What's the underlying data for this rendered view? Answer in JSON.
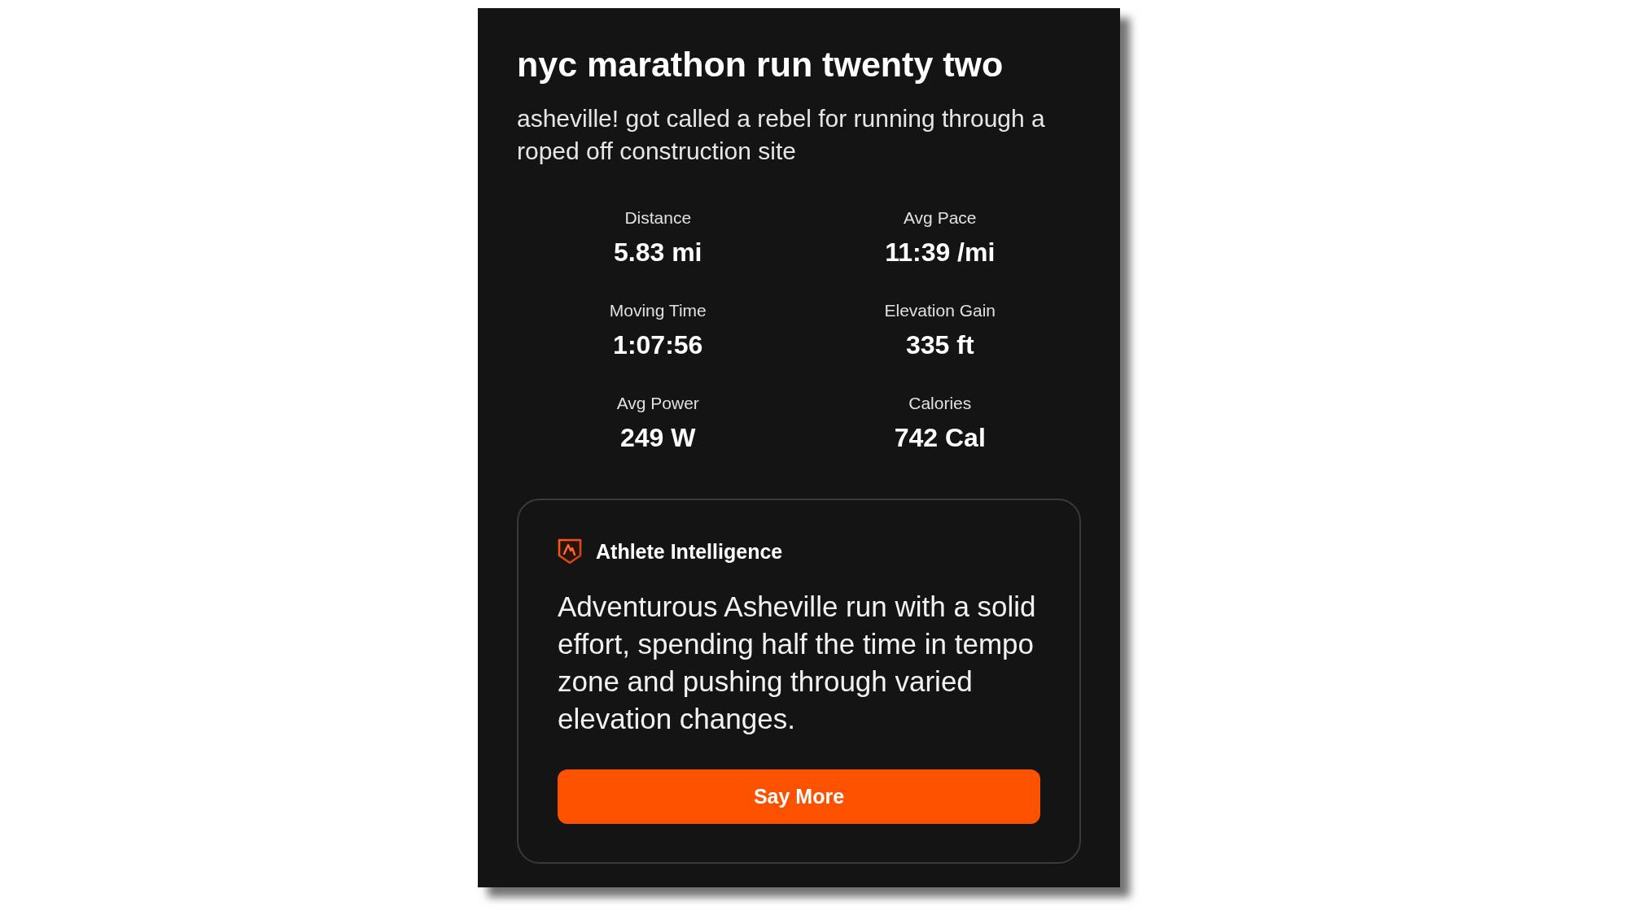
{
  "activity": {
    "title": "nyc marathon run twenty two",
    "description": "asheville! got called a rebel for running through a roped off construction site"
  },
  "stats": [
    {
      "label": "Distance",
      "value": "5.83 mi"
    },
    {
      "label": "Avg Pace",
      "value": "11:39 /mi"
    },
    {
      "label": "Moving Time",
      "value": "1:07:56"
    },
    {
      "label": "Elevation Gain",
      "value": "335 ft"
    },
    {
      "label": "Avg Power",
      "value": "249 W"
    },
    {
      "label": "Calories",
      "value": "742 Cal"
    }
  ],
  "insight": {
    "title": "Athlete Intelligence",
    "text": "Adventurous Asheville run with a solid effort, spending half the time in tempo zone and pushing through varied elevation changes.",
    "button": "Say More"
  }
}
